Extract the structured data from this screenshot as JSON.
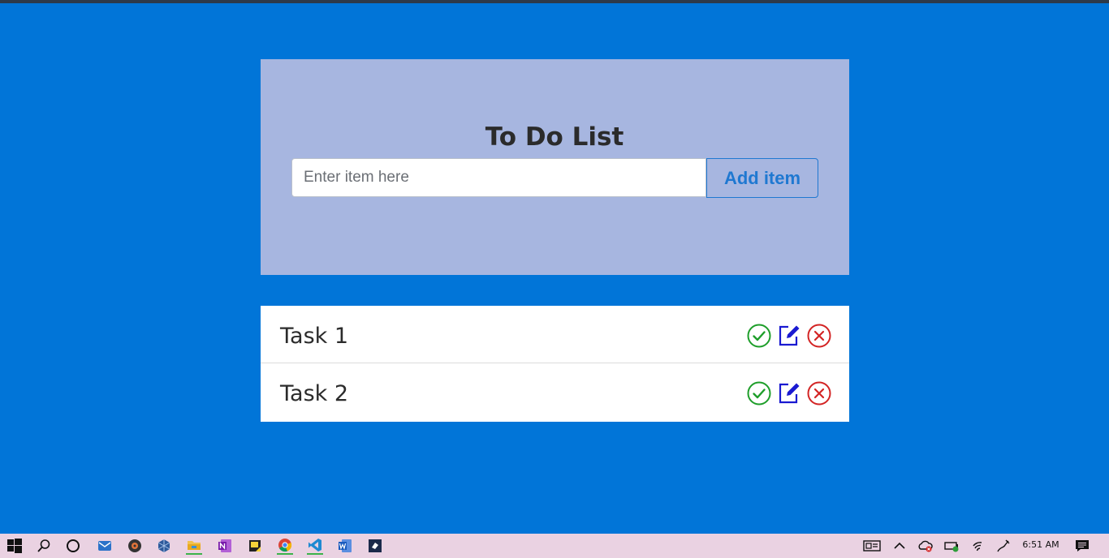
{
  "app": {
    "title": "To Do List",
    "input_placeholder": "Enter item here",
    "input_value": "",
    "add_button_label": "Add item"
  },
  "tasks": [
    {
      "name": "Task 1"
    },
    {
      "name": "Task 2"
    }
  ],
  "task_action_icons": [
    "check-circle-icon",
    "edit-icon",
    "close-circle-icon"
  ],
  "taskbar": {
    "icons": [
      "windows-start-icon",
      "search-icon",
      "cortana-icon",
      "mail-icon",
      "media-icon",
      "virtualbox-icon",
      "file-explorer-icon",
      "onenote-icon",
      "sticky-notes-icon",
      "chrome-icon",
      "vscode-icon",
      "word-icon",
      "app-icon"
    ],
    "tray_icons": [
      "news-icon",
      "chevron-up-icon",
      "onedrive-icon",
      "battery-icon",
      "wifi-icon",
      "pen-icon"
    ],
    "clock": "6:51 AM",
    "notification_icon": "action-center-icon"
  },
  "colors": {
    "background": "#0175d8",
    "header_card": "#a7b6e0",
    "accent": "#1f78d1",
    "check": "#1e9e2a",
    "edit": "#1a1ad1",
    "delete": "#d32424",
    "taskbar": "#ead2e2"
  }
}
